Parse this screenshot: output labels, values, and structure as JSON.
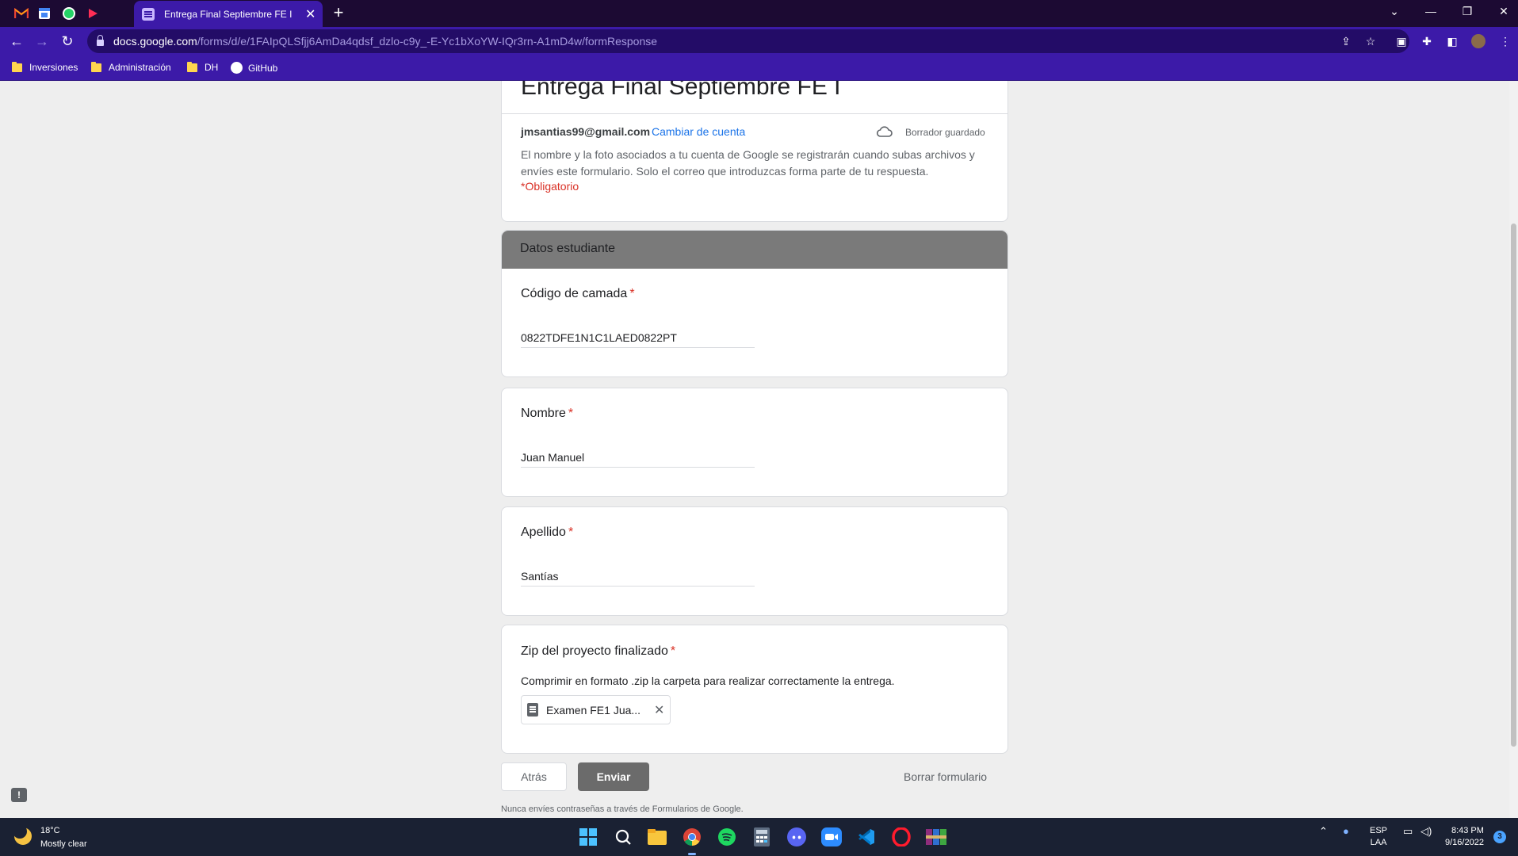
{
  "browser": {
    "pinned_tabs": [
      "gmail-icon",
      "calendar-icon",
      "whatsapp-icon",
      "youtube-icon"
    ],
    "active_tab": {
      "title": "Entrega Final Septiembre FE I"
    },
    "url_host": "docs.google.com",
    "url_path": "/forms/d/e/1FAIpQLSfjj6AmDa4qdsf_dzlo-c9y_-E-Yc1bXoYW-IQr3rn-A1mD4w/formResponse",
    "bookmarks": [
      {
        "label": "Inversiones"
      },
      {
        "label": "Administración"
      },
      {
        "label": "DH"
      },
      {
        "label": "GitHub"
      }
    ]
  },
  "form": {
    "title": "Entrega Final Septiembre FE I",
    "email": "jmsantias99@gmail.com",
    "switch_account": "Cambiar de cuenta",
    "draft_status": "Borrador guardado",
    "disclaimer": "El nombre y la foto asociados a tu cuenta de Google se registrarán cuando subas archivos y envíes este formulario. Solo el correo que introduzcas forma parte de tu respuesta.",
    "required_note": "*Obligatorio",
    "section_title": "Datos estudiante",
    "required_mark": "*",
    "questions": [
      {
        "title": "Código de camada",
        "answer": "0822TDFE1N1C1LAED0822PT"
      },
      {
        "title": "Nombre",
        "answer": "Juan Manuel"
      },
      {
        "title": "Apellido",
        "answer": "Santías"
      },
      {
        "title": "Zip del proyecto finalizado",
        "description": "Comprimir en formato .zip la carpeta para realizar correctamente la entrega.",
        "file_name": "Examen FE1 Jua..."
      }
    ],
    "back_button": "Atrás",
    "submit_button": "Enviar",
    "clear_button": "Borrar formulario",
    "footer": "Nunca envíes contraseñas a través de Formularios de Google."
  },
  "taskbar": {
    "weather_temp": "18°C",
    "weather_desc": "Mostly clear",
    "language": "ESP",
    "layout": "LAA",
    "time": "8:43 PM",
    "date": "9/16/2022",
    "notification_count": "3"
  },
  "colors": {
    "browser_frame": "#3c1aa8",
    "tab_strip": "#1c0a33",
    "required_red": "#d93025",
    "link_blue": "#1a73e8",
    "section_header": "#7a7a7a",
    "submit_button": "#6b6b6b"
  }
}
